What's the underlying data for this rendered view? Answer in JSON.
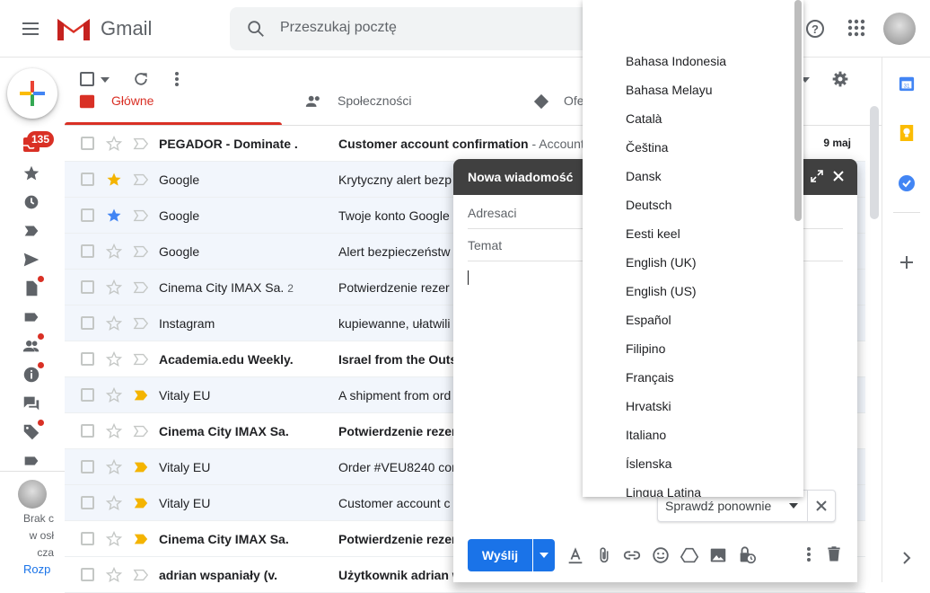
{
  "app": {
    "name": "Gmail"
  },
  "search": {
    "placeholder": "Przeszukaj pocztę"
  },
  "inbox": {
    "unread_count": "135"
  },
  "tabs": [
    {
      "label": "Główne"
    },
    {
      "label": "Społeczności"
    },
    {
      "label": "Ofe"
    }
  ],
  "emails": [
    {
      "sender": "PEGADOR - Dominate .",
      "subject": "Customer account confirmation",
      "snippet": " - Account",
      "date": "9 maj",
      "unread": true,
      "starred": false
    },
    {
      "sender": "Google",
      "subject": "Krytyczny alert bezp",
      "snippet": "",
      "date": "",
      "unread": false,
      "starred": true,
      "star_color": "#f4b400"
    },
    {
      "sender": "Google",
      "subject": "Twoje konto Google",
      "snippet": "",
      "date": "",
      "unread": false,
      "starred": true,
      "star_color": "#4285f4"
    },
    {
      "sender": "Google",
      "subject": "Alert bezpieczeństw",
      "snippet": "",
      "date": "",
      "unread": false,
      "starred": false
    },
    {
      "sender": "Cinema City IMAX Sa.",
      "count": "2",
      "subject": "Potwierdzenie rezer",
      "snippet": "",
      "date": "",
      "unread": false,
      "starred": false
    },
    {
      "sender": "Instagram",
      "subject": "kupiewanne, ułatwili",
      "snippet": "",
      "date": "",
      "unread": false,
      "starred": false
    },
    {
      "sender": "Academia.edu Weekly.",
      "subject": "Israel from the Outs",
      "snippet": "",
      "date": "",
      "unread": true,
      "starred": false
    },
    {
      "sender": "Vitaly EU",
      "subject": "A shipment from ord",
      "snippet": "",
      "date": "",
      "unread": false,
      "starred": false,
      "important": true
    },
    {
      "sender": "Cinema City IMAX Sa.",
      "subject": "Potwierdzenie rezer",
      "snippet": "",
      "date": "",
      "unread": true,
      "starred": false
    },
    {
      "sender": "Vitaly EU",
      "subject": "Order #VEU8240 cor",
      "snippet": "",
      "date": "",
      "unread": false,
      "starred": false,
      "important": true
    },
    {
      "sender": "Vitaly EU",
      "subject": "Customer account c",
      "snippet": "",
      "date": "",
      "unread": false,
      "starred": false,
      "important": true
    },
    {
      "sender": "Cinema City IMAX Sa.",
      "subject": "Potwierdzenie rezer",
      "snippet": "",
      "date": "",
      "unread": true,
      "starred": false,
      "important": true
    },
    {
      "sender": "adrian wspaniały (v.",
      "subject": "Użytkownik adrian w",
      "snippet": "",
      "date": "",
      "unread": true,
      "starred": false
    }
  ],
  "hangouts": {
    "line1": "Brak c",
    "line2": "w osł",
    "line3": "cza",
    "link": "Rozp"
  },
  "compose": {
    "title": "Nowa wiadomość",
    "to_label": "Adresaci",
    "subject_label": "Temat",
    "send_label": "Wyślij",
    "recheck_label": "Sprawdź ponownie"
  },
  "languages": [
    "Bahasa Indonesia",
    "Bahasa Melayu",
    "Català",
    "Čeština",
    "Dansk",
    "Deutsch",
    "Eesti keel",
    "English (UK)",
    "English (US)",
    "Español",
    "Filipino",
    "Français",
    "Hrvatski",
    "Italiano",
    "Íslenska",
    "Lingua Latina"
  ],
  "colors": {
    "accent_red": "#d93025",
    "send_blue": "#1a73e8",
    "compose_header": "#404040"
  }
}
